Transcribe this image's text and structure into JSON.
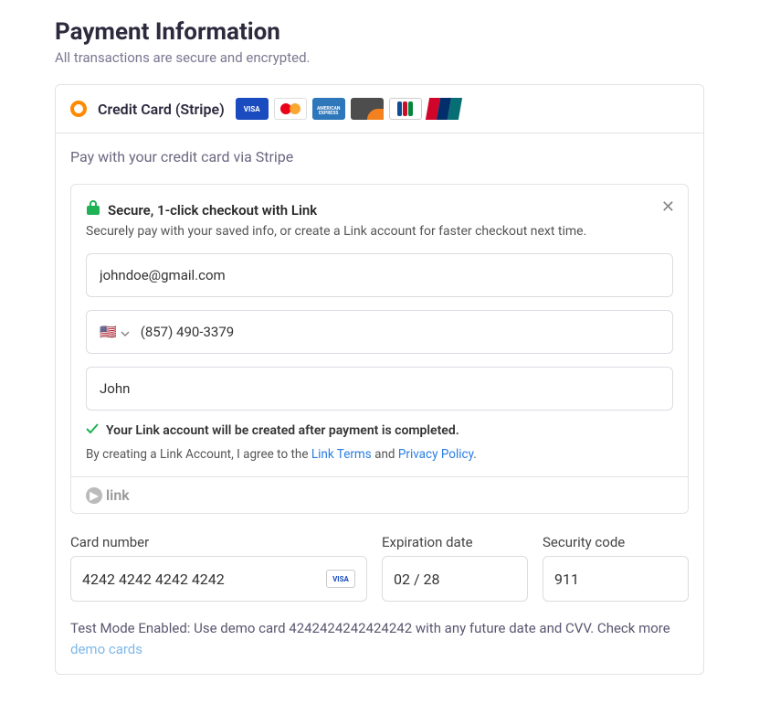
{
  "header": {
    "title": "Payment Information",
    "subtitle": "All transactions are secure and encrypted."
  },
  "method": {
    "label": "Credit Card (Stripe)",
    "logos": [
      "visa",
      "mastercard",
      "amex",
      "discover",
      "jcb",
      "unionpay"
    ]
  },
  "body": {
    "hint": "Pay with your credit card via Stripe"
  },
  "link": {
    "title": "Secure, 1-click checkout with Link",
    "subtitle": "Securely pay with your saved info, or create a Link account for faster checkout next time.",
    "email": "johndoe@gmail.com",
    "phone": "(857) 490-3379",
    "name": "John",
    "confirmation": "Your Link account will be created after payment is completed.",
    "agree_prefix": "By creating a Link Account, I agree to the ",
    "terms_label": "Link Terms",
    "agree_mid": " and ",
    "privacy_label": "Privacy Policy",
    "agree_suffix": ".",
    "brand": "link"
  },
  "card": {
    "number_label": "Card number",
    "number_value": "4242 4242 4242 4242",
    "exp_label": "Expiration date",
    "exp_value": "02 / 28",
    "cvc_label": "Security code",
    "cvc_value": "911"
  },
  "test_mode": {
    "text_prefix": "Test Mode Enabled: Use demo card 4242424242424242 with any future date and CVV. Check more ",
    "link_label": "demo cards"
  }
}
